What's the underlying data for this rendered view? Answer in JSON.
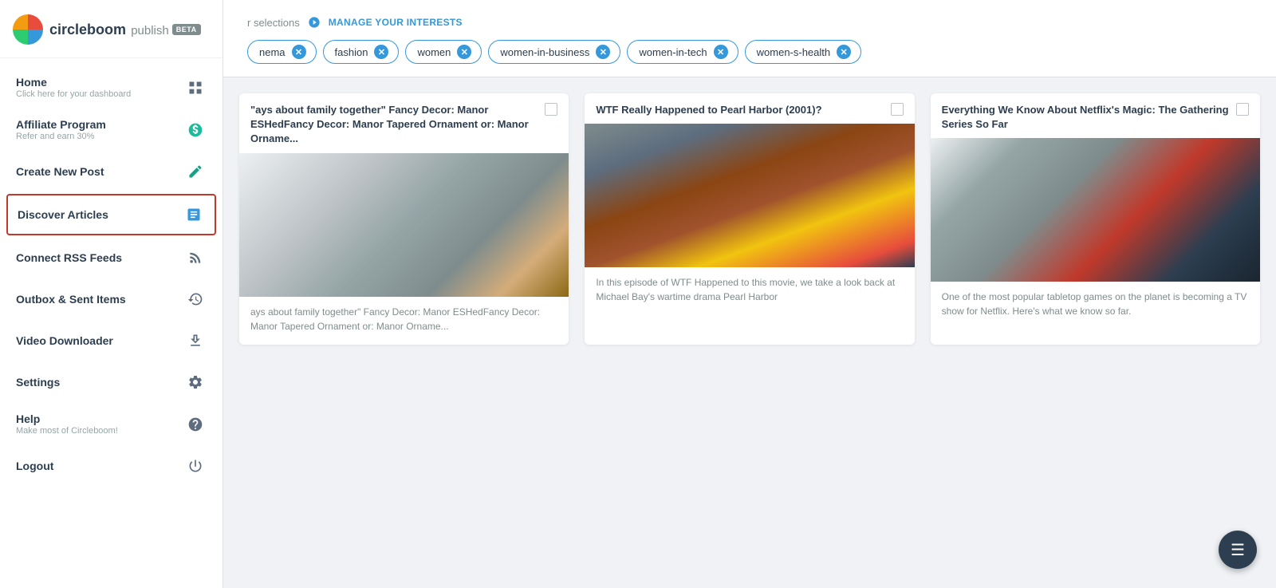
{
  "app": {
    "name": "circleboom",
    "product": "publish",
    "beta": "BETA"
  },
  "sidebar": {
    "items": [
      {
        "id": "home",
        "title": "Home",
        "subtitle": "Click here for your dashboard",
        "icon": "grid-icon",
        "active": false
      },
      {
        "id": "affiliate",
        "title": "Affiliate Program",
        "subtitle": "Refer and earn 30%",
        "icon": "dollar-icon",
        "active": false
      },
      {
        "id": "create-post",
        "title": "Create New Post",
        "subtitle": "",
        "icon": "edit-icon",
        "active": false
      },
      {
        "id": "discover",
        "title": "Discover Articles",
        "subtitle": "",
        "icon": "articles-icon",
        "active": true
      },
      {
        "id": "rss",
        "title": "Connect RSS Feeds",
        "subtitle": "",
        "icon": "rss-icon",
        "active": false
      },
      {
        "id": "outbox",
        "title": "Outbox & Sent Items",
        "subtitle": "",
        "icon": "history-icon",
        "active": false
      },
      {
        "id": "video",
        "title": "Video Downloader",
        "subtitle": "",
        "icon": "download-icon",
        "active": false
      },
      {
        "id": "settings",
        "title": "Settings",
        "subtitle": "",
        "icon": "settings-icon",
        "active": false
      },
      {
        "id": "help",
        "title": "Help",
        "subtitle": "Make most of Circleboom!",
        "icon": "help-icon",
        "active": false
      },
      {
        "id": "logout",
        "title": "Logout",
        "subtitle": "",
        "icon": "power-icon",
        "active": false
      }
    ]
  },
  "header": {
    "interests_label": "r selections",
    "manage_link": "MANAGE YOUR INTERESTS",
    "tags": [
      {
        "label": "nema",
        "id": "cinema"
      },
      {
        "label": "fashion",
        "id": "fashion"
      },
      {
        "label": "women",
        "id": "women"
      },
      {
        "label": "women-in-business",
        "id": "women-in-business"
      },
      {
        "label": "women-in-tech",
        "id": "women-in-tech"
      },
      {
        "label": "women-s-health",
        "id": "women-s-health"
      }
    ]
  },
  "articles": [
    {
      "id": "article-1",
      "title": "\"ays about family together\" Fancy Decor: Manor ESHedFancy Decor: Manor Tapered Ornament or: Manor Orname...",
      "description": "ays about family together\" Fancy Decor: Manor ESHedFancy Decor: Manor Tapered Ornament or: Manor Orname...",
      "image_type": "holiday"
    },
    {
      "id": "article-2",
      "title": "WTF Really Happened to Pearl Harbor (2001)?",
      "description": "In this episode of WTF Happened to this movie, we take a look back at Michael Bay's wartime drama Pearl Harbor",
      "image_type": "pearl-harbor"
    },
    {
      "id": "article-3",
      "title": "Everything We Know About Netflix's Magic: The Gathering Series So Far",
      "description": "One of the most popular tabletop games on the planet is becoming a TV show for Netflix. Here's what we know so far.",
      "image_type": "magic"
    }
  ],
  "fab": {
    "icon": "menu-icon",
    "label": "≡"
  }
}
